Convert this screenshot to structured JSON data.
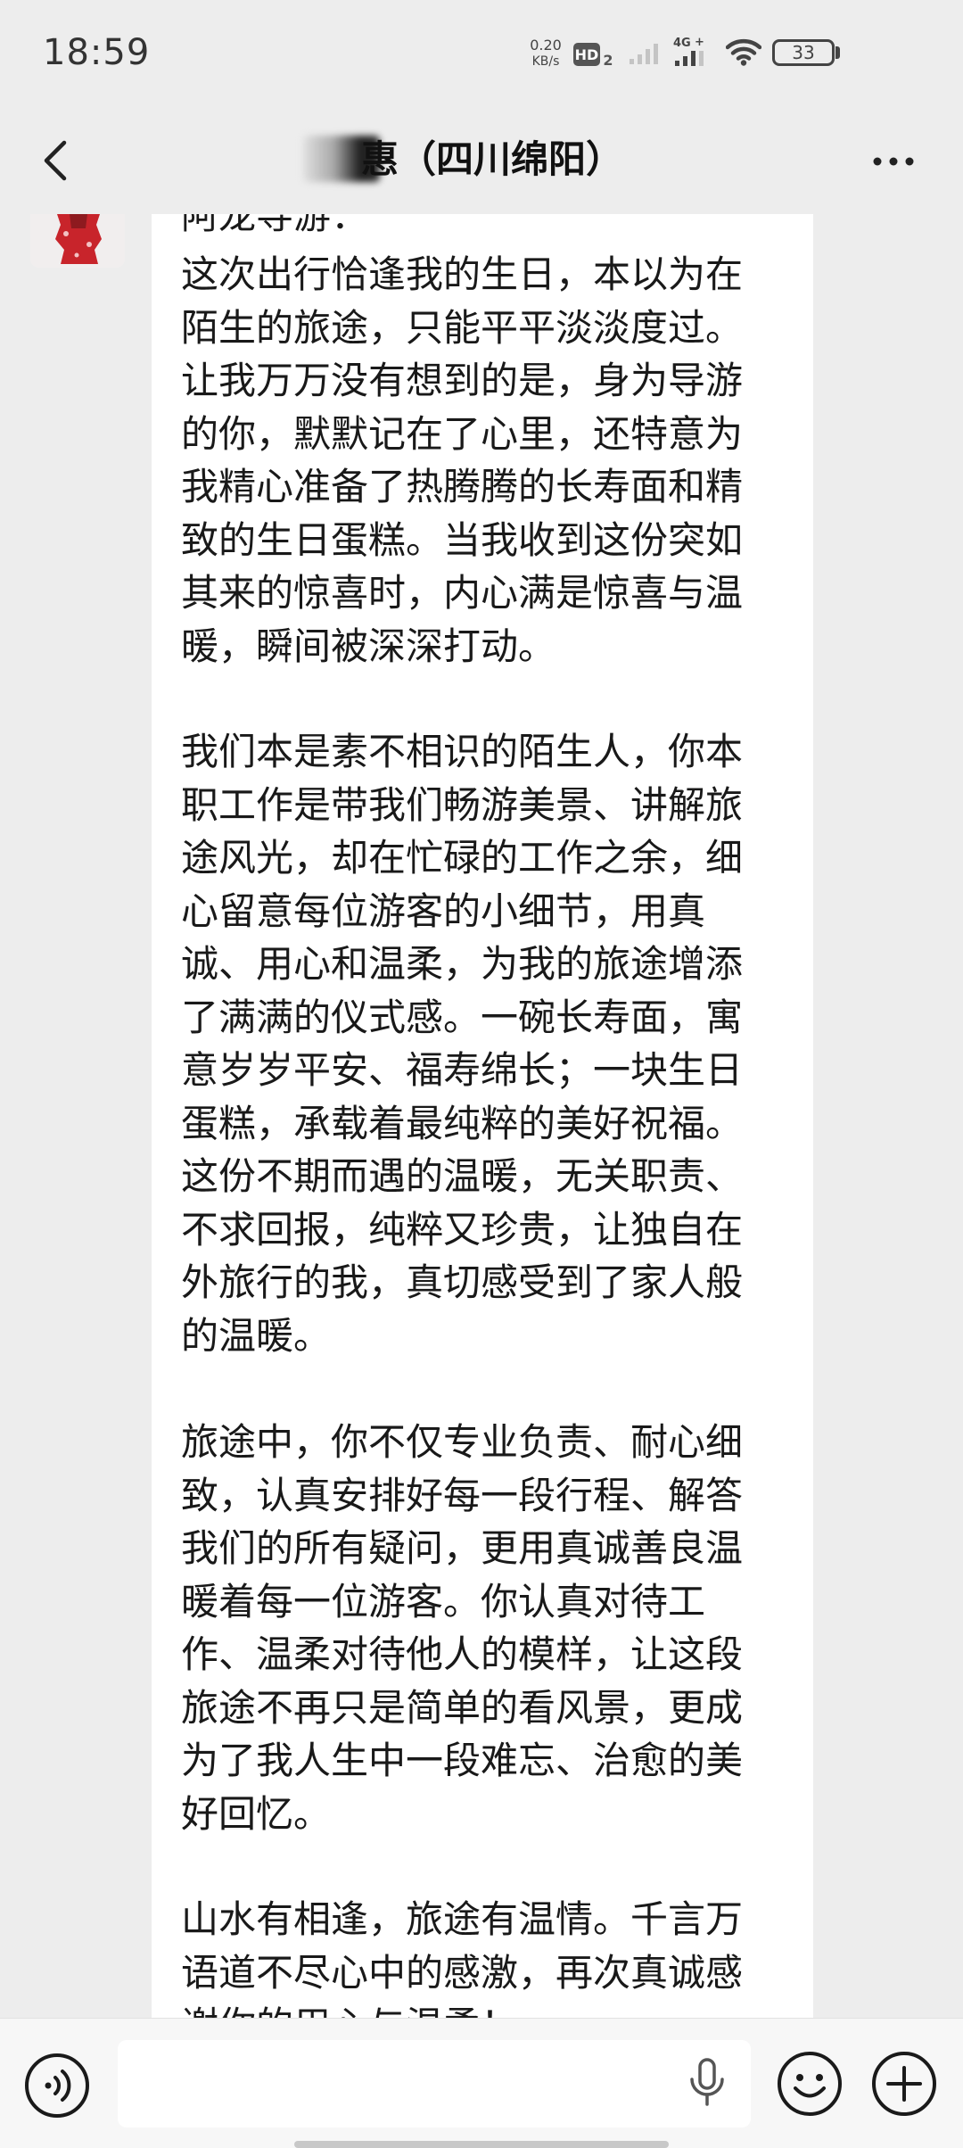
{
  "status_bar": {
    "time": "18:59",
    "net_speed_value": "0.20",
    "net_speed_unit": "KB/s",
    "hd_label": "HD",
    "hd_sub": "2",
    "network_label": "4G",
    "battery_level": "33"
  },
  "nav": {
    "title": "惠（四川绵阳）"
  },
  "message": {
    "sender_line": "阿龙导游：",
    "paragraphs": [
      {
        "lines": [
          "这次出行恰逢我的生日，本以为在",
          "陌生的旅途，只能平平淡淡度过。",
          "让我万万没有想到的是，身为导游",
          "的你，默默记在了心里，还特意为",
          "我精心准备了热腾腾的长寿面和精",
          "致的生日蛋糕。当我收到这份突如",
          "其来的惊喜时，内心满是惊喜与温",
          "暖，瞬间被深深打动。"
        ]
      },
      {
        "lines": [
          "我们本是素不相识的陌生人，你本",
          "职工作是带我们畅游美景、讲解旅",
          "途风光，却在忙碌的工作之余，细",
          "心留意每位游客的小细节，用真",
          "诚、用心和温柔，为我的旅途增添",
          "了满满的仪式感。一碗长寿面，寓",
          "意岁岁平安、福寿绵长；一块生日",
          "蛋糕，承载着最纯粹的美好祝福。",
          "这份不期而遇的温暖，无关职责、",
          "不求回报，纯粹又珍贵，让独自在",
          "外旅行的我，真切感受到了家人般",
          "的温暖。"
        ]
      },
      {
        "lines": [
          "旅途中，你不仅专业负责、耐心细",
          "致，认真安排好每一段行程、解答",
          "我们的所有疑问，更用真诚善良温",
          "暖着每一位游客。你认真对待工",
          "作、温柔对待他人的模样，让这段",
          "旅途不再只是简单的看风景，更成",
          "为了我人生中一段难忘、治愈的美",
          "好回忆。"
        ]
      },
      {
        "lines": [
          "山水有相逢，旅途有温情。千言万",
          "语道不尽心中的感激，再次真诚感",
          "谢你的用心与温柔！"
        ]
      }
    ]
  },
  "input_bar": {
    "placeholder": ""
  },
  "colors": {
    "page_background": "#ededed",
    "bubble_background": "#ffffff",
    "text": "#191919",
    "input_bar_background": "#f7f7f7"
  },
  "icons": {
    "back": "chevron-left-icon",
    "more": "more-dots-icon",
    "voice": "voice-icon",
    "mic": "microphone-icon",
    "emoji": "smiley-icon",
    "plus": "plus-circle-icon"
  }
}
